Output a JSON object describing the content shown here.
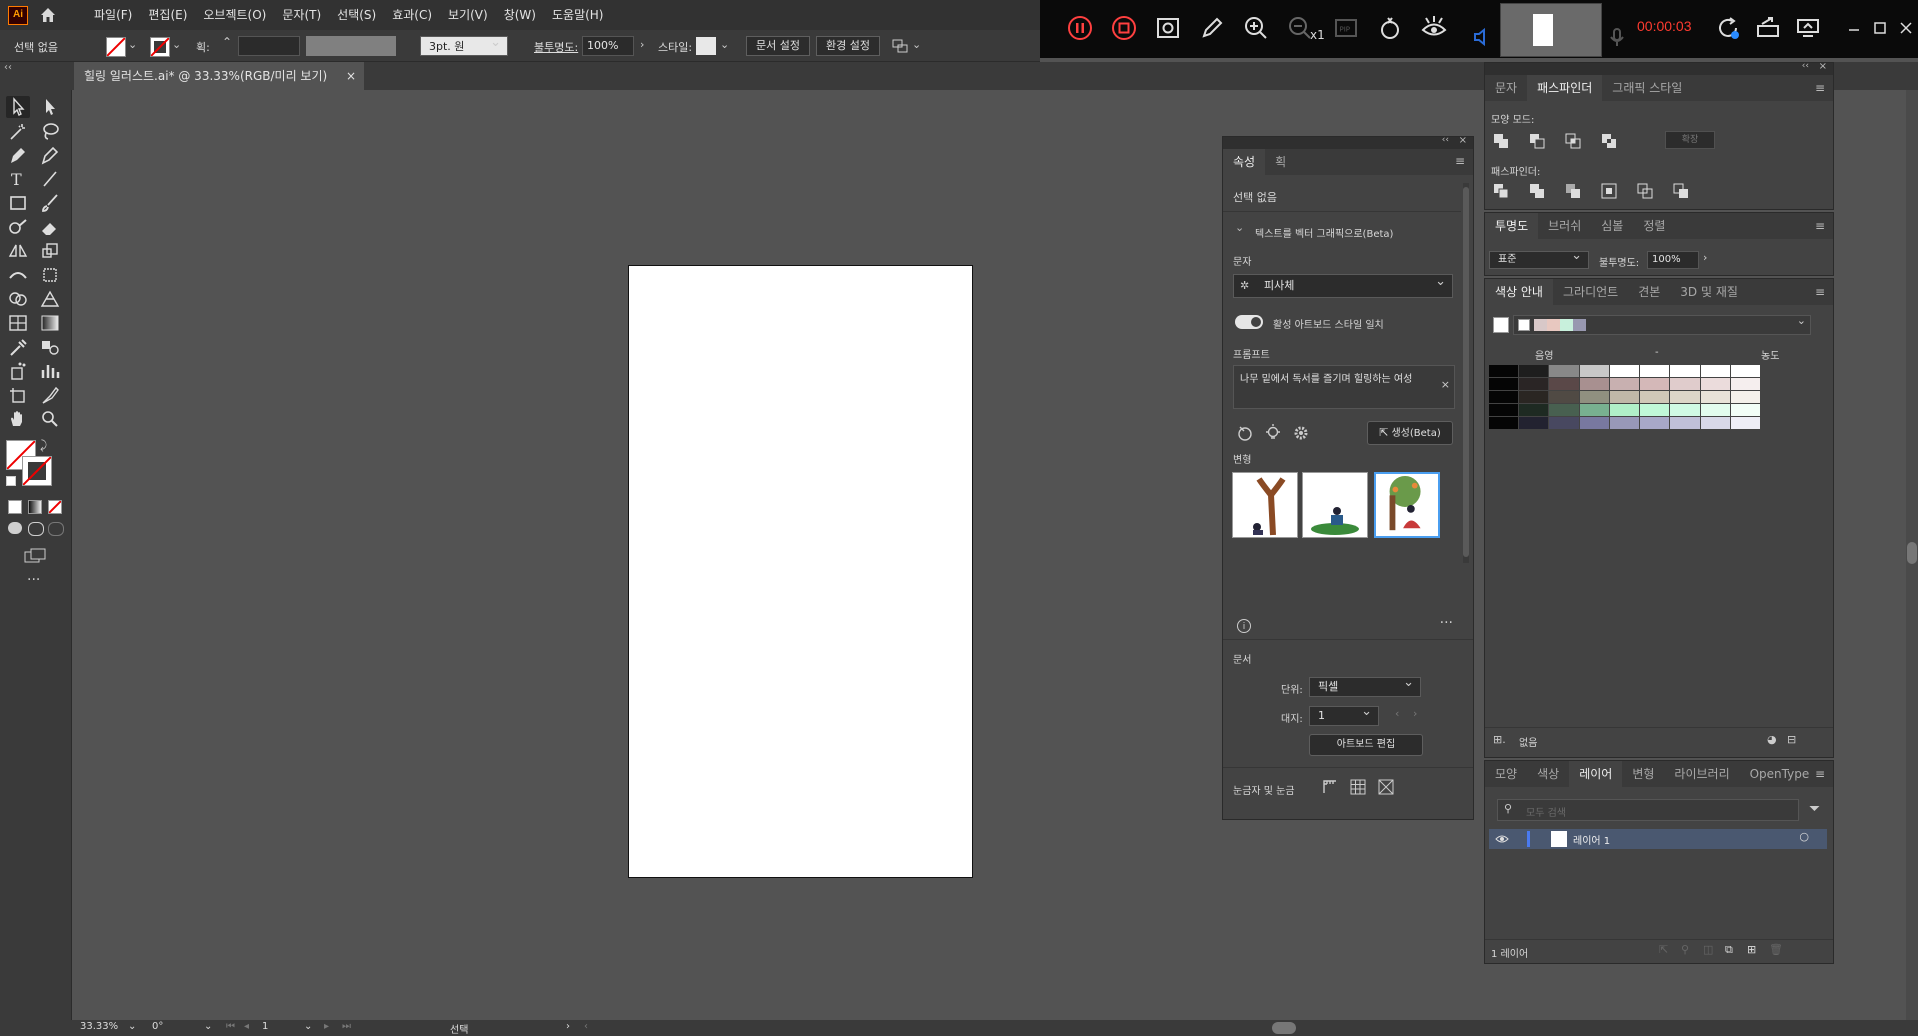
{
  "app": {
    "logo": "Ai",
    "menu": [
      "파일(F)",
      "편집(E)",
      "오브젝트(O)",
      "문자(T)",
      "선택(S)",
      "효과(C)",
      "보기(V)",
      "창(W)",
      "도움말(H)"
    ]
  },
  "recorder": {
    "time": "00:00:03",
    "zoom_badge": "x1",
    "icons": [
      "pause-icon",
      "stop-icon",
      "screenshot-icon",
      "pen-icon",
      "zoom-in-icon",
      "zoom-out-icon",
      "pip-icon",
      "touch-icon",
      "eye-icon",
      "speaker-icon",
      "mic-icon",
      "refresh-icon",
      "layout-icon",
      "monitor-icon",
      "minimize-icon",
      "maximize-icon",
      "close-icon"
    ]
  },
  "control_bar": {
    "selection": "선택 없음",
    "stroke_label": "획:",
    "stroke_style": "3pt. 원",
    "opacity_label": "불투명도:",
    "opacity_value": "100%",
    "style_label": "스타일:",
    "doc_setup_button": "문서 설정",
    "prefs_button": "환경 설정"
  },
  "document_tab": {
    "title": "힐링 일러스트.ai* @ 33.33%(RGB/미리 보기)",
    "close": "×"
  },
  "properties_panel": {
    "tabs": [
      "속성",
      "획"
    ],
    "selection": "선택 없음",
    "section_text_to_vector": "텍스트를 벡터 그래픽으로(Beta)",
    "subject_label": "문자",
    "subject_value": "피사체",
    "toggle_label": "활성 아트보드 스타일 일치",
    "prompt_label": "프롬프트",
    "prompt_value": "나무 밑에서 독서를 즐기며 힐링하는 여성",
    "generate_button": "생성(Beta)",
    "variations_label": "변형",
    "document_label": "문서",
    "unit_label": "단위:",
    "unit_value": "픽셀",
    "artboard_label": "대지:",
    "artboard_value": "1",
    "edit_artboard_button": "아트보드 편집",
    "ruler_grid_label": "눈금자 및 눈금"
  },
  "pathfinder_panel": {
    "tabs": [
      "문자",
      "패스파인더",
      "그래픽 스타일"
    ],
    "shape_modes_label": "모양 모드:",
    "expand_button": "확장",
    "pathfinders_label": "패스파인더:"
  },
  "transparency_panel": {
    "tabs": [
      "투명도",
      "브러쉬",
      "심볼",
      "정렬"
    ],
    "blend_mode": "표준",
    "opacity_label": "불투명도:",
    "opacity_value": "100%"
  },
  "color_guide_panel": {
    "tabs": [
      "색상 안내",
      "그라디언트",
      "견본",
      "3D 및 재질"
    ],
    "shade_label": "음영",
    "mid_label": "-",
    "tint_label": "농도",
    "footer_label": "없음",
    "harmony_colors": [
      "#ffffff",
      "#d8c8c8",
      "#e8c8c0",
      "#c8f0dc",
      "#9898b0"
    ],
    "swatch_rows": [
      [
        "#050505",
        "#1e1e1e",
        "#888888",
        "#c8c8c8",
        "#ffffff",
        "#ffffff",
        "#ffffff",
        "#ffffff",
        "#ffffff"
      ],
      [
        "#050505",
        "#2a2525",
        "#5a4848",
        "#a89090",
        "#c8b0b0",
        "#d4b8b8",
        "#e0cccc",
        "#ebdcdc",
        "#f5eeee"
      ],
      [
        "#050505",
        "#2a2622",
        "#504a44",
        "#909080",
        "#c0b8a8",
        "#d0c8b8",
        "#ddd6c8",
        "#e8e2d8",
        "#f4f0ea"
      ],
      [
        "#050505",
        "#1e2a22",
        "#486050",
        "#78b090",
        "#b0f0c8",
        "#c0f8d8",
        "#d0fae4",
        "#e2fcee",
        "#f2fef7"
      ],
      [
        "#050505",
        "#222230",
        "#484860",
        "#7878a0",
        "#9898b8",
        "#a8a8c8",
        "#c0c0d8",
        "#d8d8e8",
        "#eeeef6"
      ]
    ]
  },
  "layers_panel": {
    "tabs": [
      "모양",
      "색상",
      "레이어",
      "변형",
      "라이브러리",
      "OpenType"
    ],
    "search_placeholder": "모두 검색",
    "layer_name": "레이어 1",
    "footer_count": "1 레이어"
  },
  "status_bar": {
    "zoom": "33.33%",
    "rotation": "0°",
    "artboard": "1",
    "tool": "선택"
  }
}
